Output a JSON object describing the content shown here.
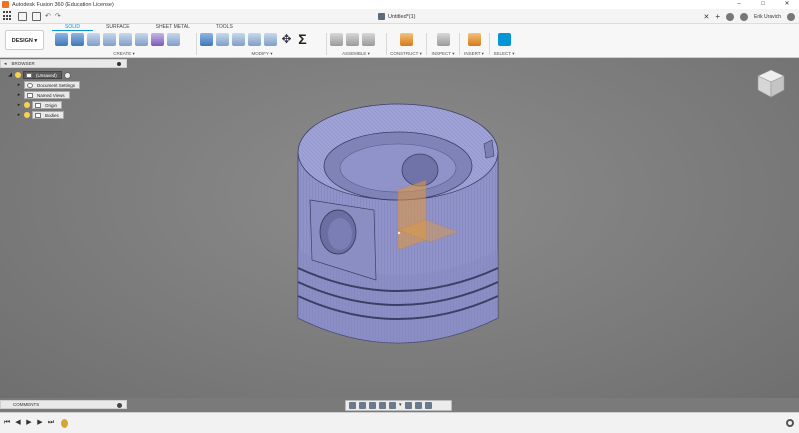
{
  "window": {
    "title": "Autodesk Fusion 360 (Education License)",
    "controls": [
      "–",
      "□",
      "✕"
    ]
  },
  "quick_access": {
    "document_title": "Untitled*(1)",
    "user_name": "Erik Uravich"
  },
  "toolbar": {
    "workspace_label": "DESIGN ▾",
    "tabs": [
      {
        "label": "SOLID",
        "active": true
      },
      {
        "label": "SURFACE",
        "active": false
      },
      {
        "label": "SHEET METAL",
        "active": false
      },
      {
        "label": "TOOLS",
        "active": false
      }
    ],
    "groups": {
      "create": "CREATE ▾",
      "modify": "MODIFY ▾",
      "assemble": "ASSEMBLE ▾",
      "construct": "CONSTRUCT ▾",
      "inspect": "INSPECT ▾",
      "insert": "INSERT ▾",
      "select": "SELECT ▾"
    }
  },
  "browser": {
    "header": "BROWSER",
    "items": [
      {
        "label": "(Unsaved)",
        "root": true
      },
      {
        "label": "Document Settings",
        "icon": "gear-icon"
      },
      {
        "label": "Named Views",
        "icon": "folder-icon"
      },
      {
        "label": "Origin",
        "icon": "folder-icon"
      },
      {
        "label": "Bodies",
        "icon": "folder-icon"
      }
    ]
  },
  "comments": {
    "header": "COMMENTS"
  },
  "colors": {
    "accent": "#0696d7",
    "model_fill": "#8f93c9",
    "model_edge": "#3b3f66",
    "plane": "#e39a3b",
    "viewport_bg": "#7a7a7a"
  }
}
